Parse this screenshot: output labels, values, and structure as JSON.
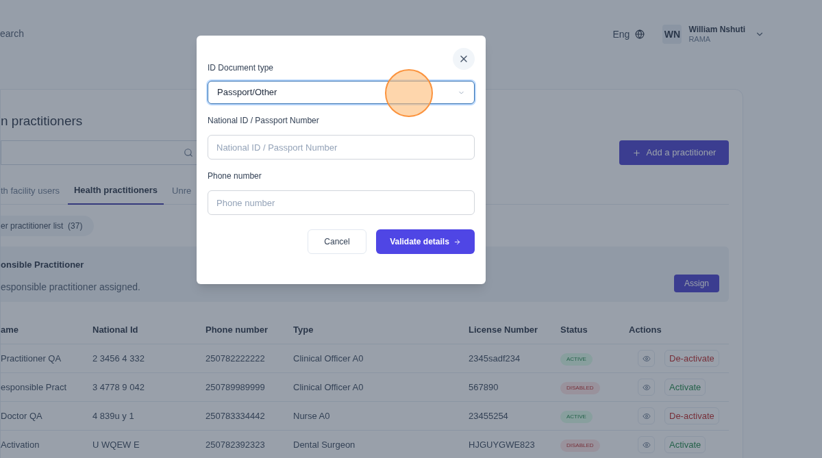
{
  "header": {
    "search_label": "earch",
    "language": "Eng",
    "user": {
      "initials": "WN",
      "name": "William Nshuti",
      "org": "RAMA"
    }
  },
  "page": {
    "title": "n practitioners",
    "add_button": "Add a practitioner",
    "tabs": [
      {
        "label": "th facility users",
        "selected": false
      },
      {
        "label": "Health practitioners",
        "selected": true
      },
      {
        "label": "Unre",
        "selected": false
      }
    ],
    "list_pill": "er practitioner list  (37)",
    "responsible": {
      "title": "onsible Practitioner",
      "text": "esponsible practitioner assigned.",
      "button": "Assign"
    },
    "table": {
      "columns": [
        "ame",
        "National Id",
        "Phone number",
        "Type",
        "License Number",
        "Status",
        "Actions"
      ],
      "rows": [
        {
          "name": "Practitioner QA",
          "national_id": "2 3456 4 332",
          "phone": "250782222222",
          "type": "Clinical Officer A0",
          "license": "2345sadf234",
          "status": {
            "kind": "active",
            "label": "ACTIVE"
          },
          "action": {
            "kind": "deactivate",
            "label": "De-activate"
          }
        },
        {
          "name": "esponsible Pract",
          "national_id": "3 4778 9 042",
          "phone": "250789989999",
          "type": "Clinical Officer A0",
          "license": "567890",
          "status": {
            "kind": "disabled",
            "label": "DISABLED"
          },
          "action": {
            "kind": "activate",
            "label": "Activate"
          }
        },
        {
          "name": "Doctor QA",
          "national_id": "4 839u y 1",
          "phone": "250783334442",
          "type": "Nurse A0",
          "license": "23455254",
          "status": {
            "kind": "active",
            "label": "ACTIVE"
          },
          "action": {
            "kind": "deactivate",
            "label": "De-activate"
          }
        },
        {
          "name": "Activation",
          "national_id": "U WQEW E",
          "phone": "250782392323",
          "type": "Dental Surgeon",
          "license": "HJGUYGWE823",
          "status": {
            "kind": "disabled",
            "label": "DISABLED"
          },
          "action": {
            "kind": "activate",
            "label": "Activate"
          }
        }
      ]
    }
  },
  "dialog": {
    "doc_type": {
      "label": "ID Document type",
      "value": "Passport/Other",
      "focused": true
    },
    "id_number": {
      "label": "National ID / Passport Number",
      "placeholder": "National ID / Passport Number"
    },
    "phone": {
      "label": "Phone number",
      "placeholder": "Phone number"
    },
    "cancel": "Cancel",
    "validate": "Validate details"
  }
}
